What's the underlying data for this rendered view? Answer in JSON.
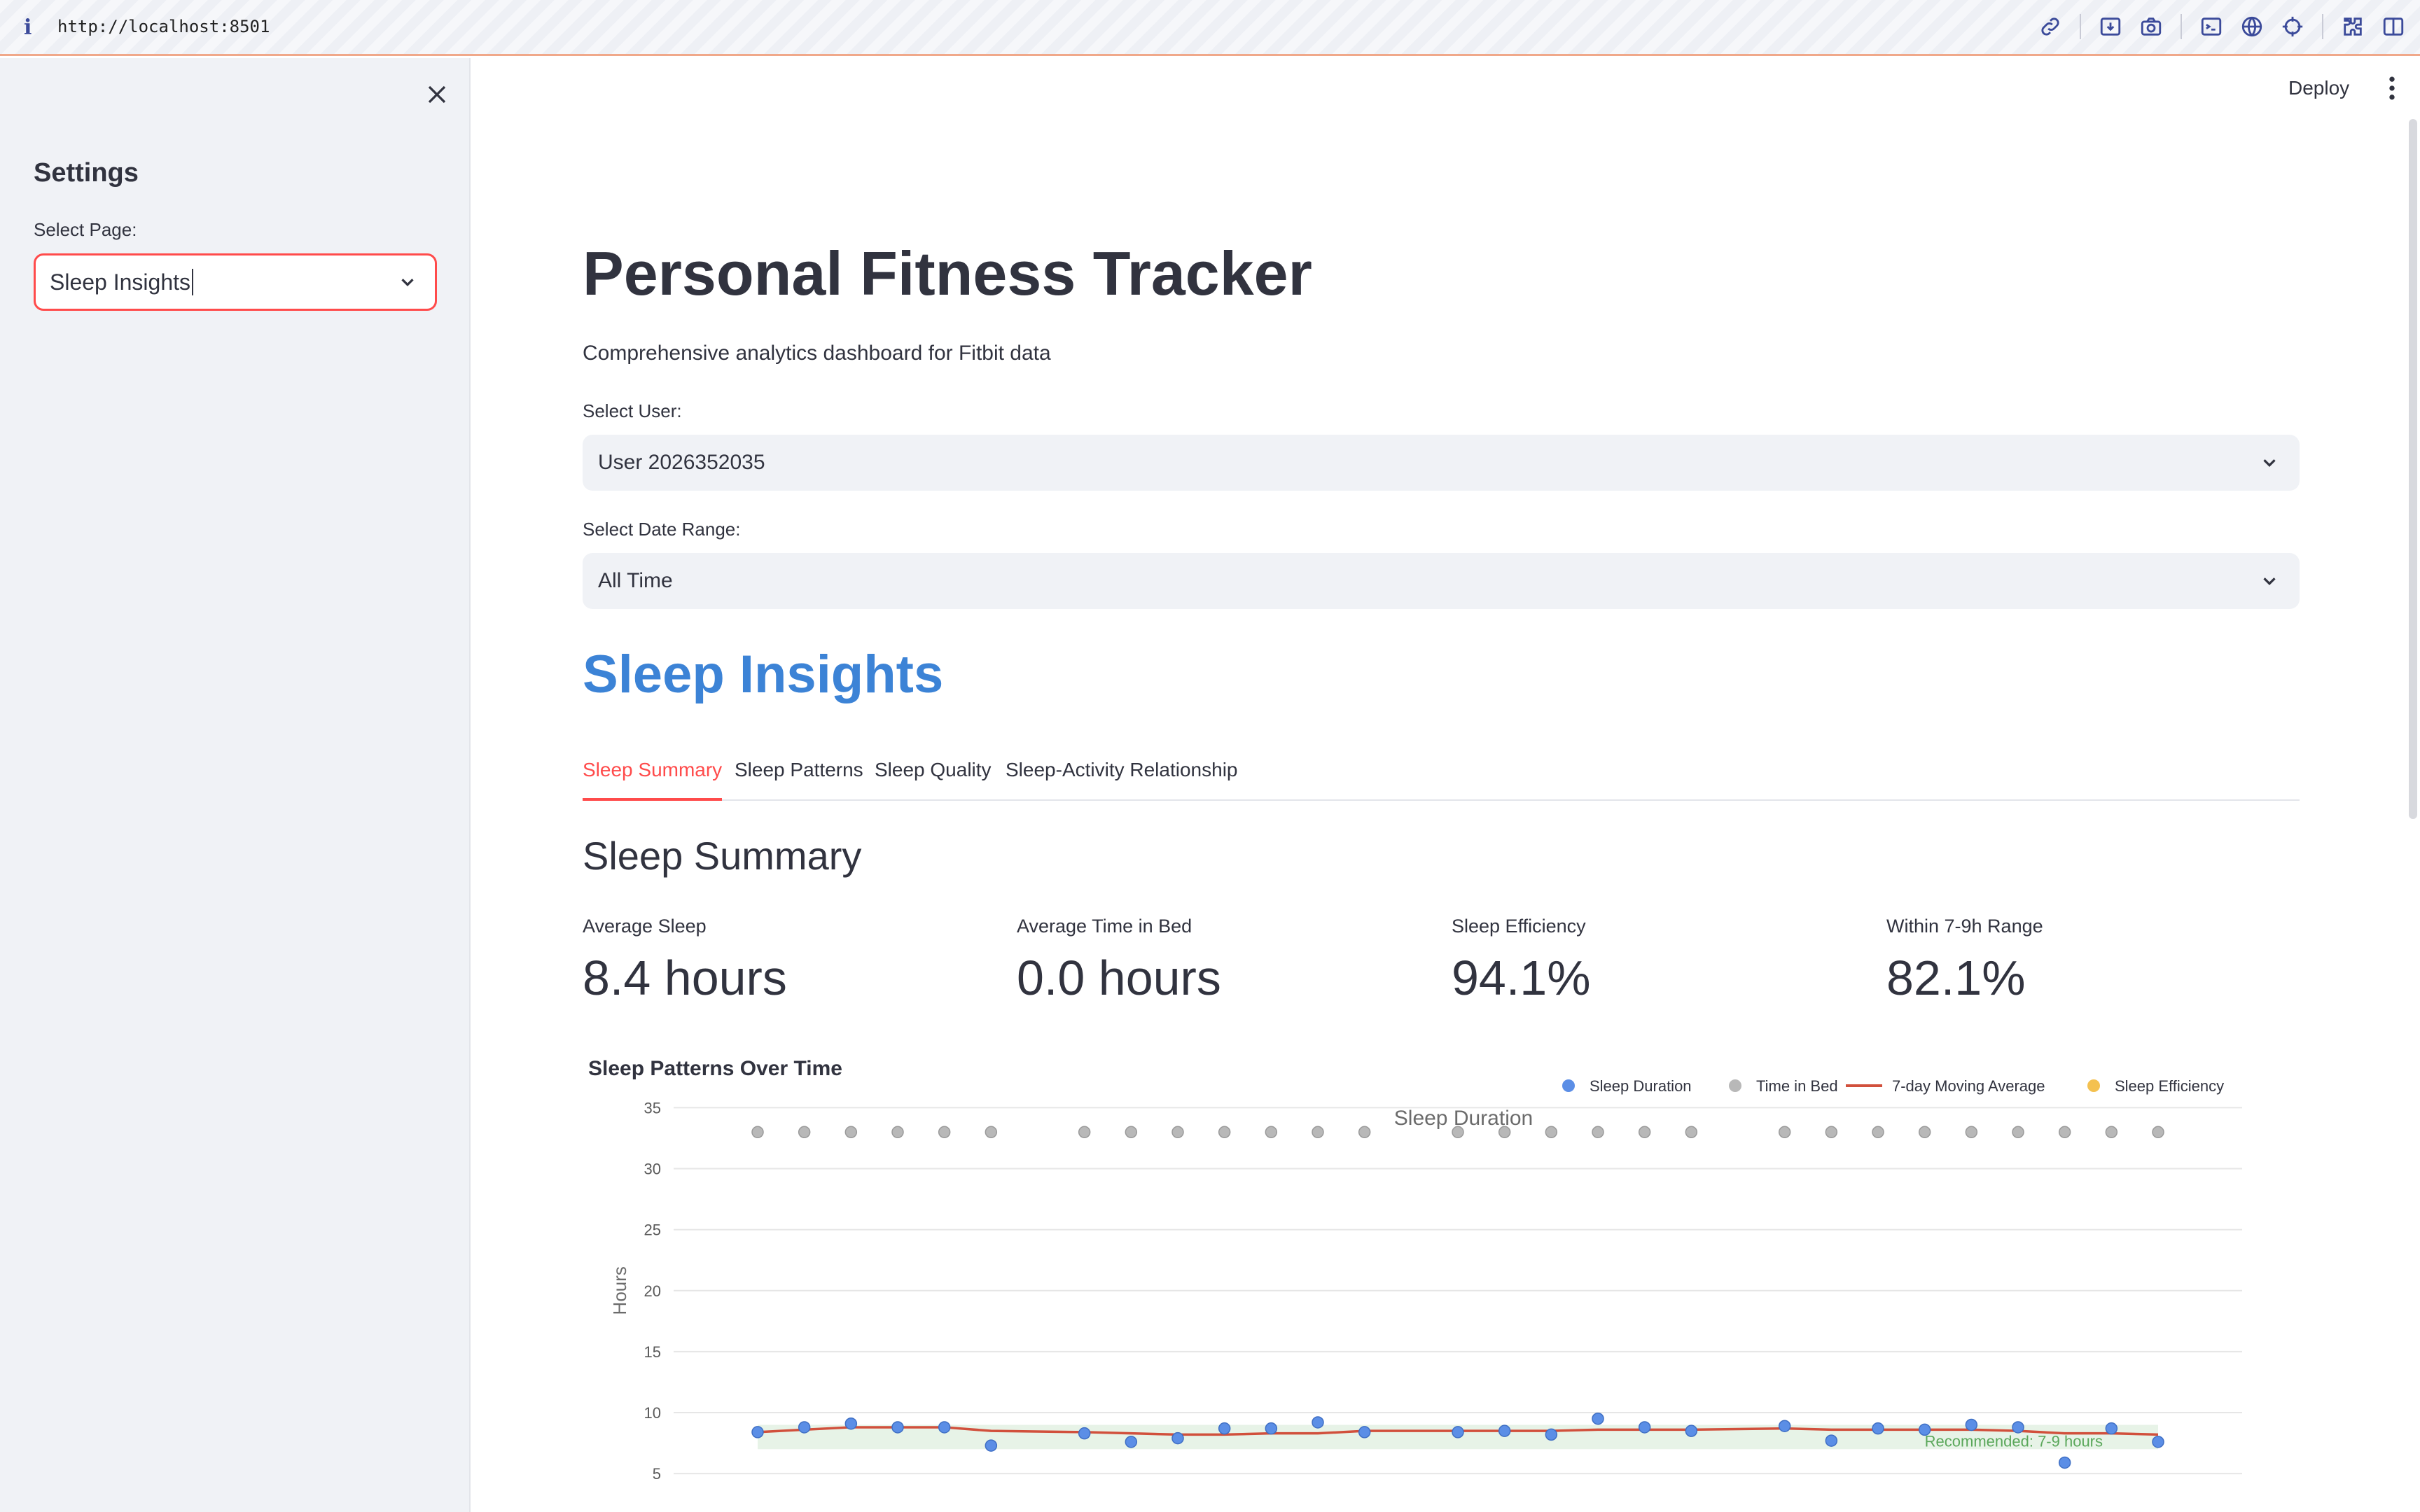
{
  "browser": {
    "info_glyph": "i",
    "url": "http://localhost:8501"
  },
  "sidebar": {
    "title": "Settings",
    "select_label": "Select Page:",
    "select_value": "Sleep Insights"
  },
  "header": {
    "deploy_label": "Deploy"
  },
  "main": {
    "title": "Personal Fitness Tracker",
    "subtitle": "Comprehensive analytics dashboard for Fitbit data",
    "user_label": "Select User:",
    "user_value": "User 2026352035",
    "range_label": "Select Date Range:",
    "range_value": "All Time",
    "section_title": "Sleep Insights",
    "tabs": [
      {
        "label": "Sleep Summary",
        "active": true
      },
      {
        "label": "Sleep Patterns",
        "active": false
      },
      {
        "label": "Sleep Quality",
        "active": false
      },
      {
        "label": "Sleep-Activity Relationship",
        "active": false
      }
    ],
    "summary_title": "Sleep Summary",
    "metrics": [
      {
        "label": "Average Sleep",
        "value": "8.4 hours"
      },
      {
        "label": "Average Time in Bed",
        "value": "0.0 hours"
      },
      {
        "label": "Sleep Efficiency",
        "value": "94.1%"
      },
      {
        "label": "Within 7-9h Range",
        "value": "82.1%"
      }
    ]
  },
  "colors": {
    "accent": "#ff4b4b",
    "section_blue": "#3c83d6",
    "sleep_duration": "#5b8ee6",
    "time_in_bed": "#b8b8b8",
    "moving_avg": "#d1503c",
    "sleep_efficiency": "#f4c150",
    "recommended_band": "#e3f1e3",
    "recommended_text": "#5aa75a"
  },
  "chart_data": {
    "type": "scatter",
    "title": "Sleep Patterns Over Time",
    "subtitle": "Sleep Duration",
    "ylabel": "Hours",
    "ylim": [
      3,
      36
    ],
    "yticks": [
      5,
      10,
      15,
      20,
      25,
      30,
      35
    ],
    "grid": true,
    "legend_position": "top-right",
    "recommended_band": {
      "low": 7,
      "high": 9,
      "label": "Recommended: 7-9 hours"
    },
    "x": [
      0,
      1,
      2,
      3,
      4,
      5,
      7,
      8,
      9,
      10,
      11,
      12,
      13,
      15,
      16,
      17,
      18,
      19,
      20,
      22,
      23,
      24,
      25,
      26,
      27,
      28,
      29,
      30
    ],
    "series": [
      {
        "name": "Sleep Duration",
        "kind": "points",
        "values": [
          8.4,
          8.8,
          9.1,
          8.8,
          8.8,
          7.3,
          8.3,
          7.6,
          7.9,
          8.7,
          8.7,
          9.2,
          8.4,
          8.4,
          8.5,
          8.2,
          9.5,
          8.8,
          8.5,
          8.9,
          7.7,
          8.7,
          8.6,
          9.0,
          8.8,
          5.9,
          8.7,
          7.6
        ]
      },
      {
        "name": "Time in Bed",
        "kind": "points",
        "values": [
          33,
          33,
          33,
          33,
          33,
          33,
          33,
          33,
          33,
          33,
          33,
          33,
          33,
          33,
          33,
          33,
          33,
          33,
          33,
          33,
          33,
          33,
          33,
          33,
          33,
          33,
          33,
          33
        ]
      },
      {
        "name": "7-day Moving Average",
        "kind": "line",
        "values": [
          8.4,
          8.6,
          8.8,
          8.8,
          8.8,
          8.5,
          8.4,
          8.3,
          8.2,
          8.2,
          8.3,
          8.3,
          8.5,
          8.5,
          8.5,
          8.5,
          8.6,
          8.6,
          8.6,
          8.7,
          8.6,
          8.6,
          8.6,
          8.6,
          8.5,
          8.3,
          8.3,
          8.2
        ]
      },
      {
        "name": "Sleep Efficiency",
        "kind": "points",
        "values": []
      }
    ]
  }
}
